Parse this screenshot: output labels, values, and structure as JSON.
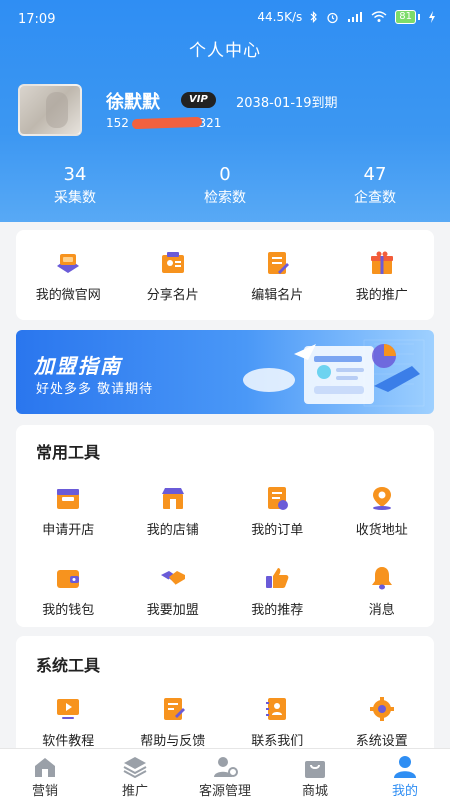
{
  "status_bar": {
    "time": "17:09",
    "network_speed": "44.5K/s",
    "battery": "81"
  },
  "header": {
    "title": "个人中心"
  },
  "profile": {
    "name": "徐默默",
    "badge": "VIP",
    "expire": "2038-01-19到期",
    "phone_prefix": "152",
    "phone_suffix": "0321"
  },
  "stats": [
    {
      "value": "34",
      "label": "采集数"
    },
    {
      "value": "0",
      "label": "检索数"
    },
    {
      "value": "47",
      "label": "企查数"
    }
  ],
  "quick_menu": [
    {
      "label": "我的微官网",
      "icon": "website-icon"
    },
    {
      "label": "分享名片",
      "icon": "share-card-icon"
    },
    {
      "label": "编辑名片",
      "icon": "edit-card-icon"
    },
    {
      "label": "我的推广",
      "icon": "gift-icon"
    }
  ],
  "banner": {
    "title": "加盟指南",
    "subtitle": "好处多多  敬请期待"
  },
  "common_tools": {
    "title": "常用工具",
    "items": [
      {
        "label": "申请开店",
        "icon": "open-shop-icon"
      },
      {
        "label": "我的店铺",
        "icon": "store-icon"
      },
      {
        "label": "我的订单",
        "icon": "order-icon"
      },
      {
        "label": "收货地址",
        "icon": "location-icon"
      },
      {
        "label": "我的钱包",
        "icon": "wallet-icon"
      },
      {
        "label": "我要加盟",
        "icon": "handshake-icon"
      },
      {
        "label": "我的推荐",
        "icon": "thumbs-up-icon"
      },
      {
        "label": "消息",
        "icon": "bell-icon"
      }
    ]
  },
  "system_tools": {
    "title": "系统工具",
    "items": [
      {
        "label": "软件教程",
        "icon": "video-tutorial-icon"
      },
      {
        "label": "帮助与反馈",
        "icon": "feedback-icon"
      },
      {
        "label": "联系我们",
        "icon": "contact-book-icon"
      },
      {
        "label": "系统设置",
        "icon": "settings-gear-icon"
      }
    ]
  },
  "tabbar": [
    {
      "label": "营销",
      "icon": "home-icon",
      "active": false
    },
    {
      "label": "推广",
      "icon": "layers-icon",
      "active": false
    },
    {
      "label": "客源管理",
      "icon": "user-gear-icon",
      "active": false
    },
    {
      "label": "商城",
      "icon": "shopping-bag-icon",
      "active": false
    },
    {
      "label": "我的",
      "icon": "profile-icon",
      "active": true
    }
  ],
  "colors": {
    "primary": "#2f8ef3",
    "accent_orange": "#f7931e",
    "accent_purple": "#6a5bd8"
  }
}
